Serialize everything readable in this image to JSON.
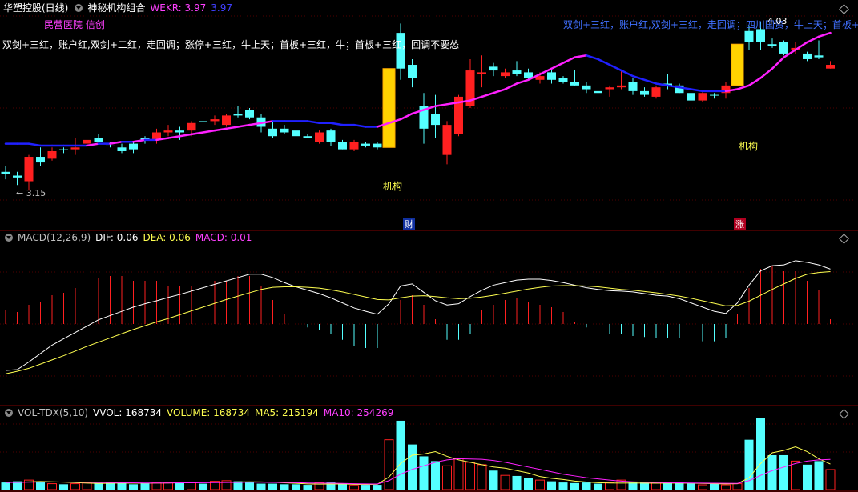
{
  "header": {
    "stock": "华塑控股(日线)",
    "indicator": "神秘机构组合",
    "wekr_label": "WEKR: 3.97",
    "wekr_value2": "3.97"
  },
  "main": {
    "tag_hospital": "民营医院 信创",
    "strategy_left": "双剑+三红，账户红,双剑+二红，走回调；涨停+三红，牛上天；首板+三红，牛；首板+三红，回调不要怂",
    "strategy_right": "双剑+三红，账户红,双剑+三红，走回调；四川国资，牛上天；首板+",
    "label_jigou": "机构",
    "low_marker": "← 3.15",
    "peak_marker": "4.03",
    "marker_cai": "财",
    "marker_zhang": "涨"
  },
  "macd_header": {
    "title": "MACD(12,26,9)",
    "dif": "DIF: 0.06",
    "dea": "DEA: 0.06",
    "macd": "MACD: 0.01"
  },
  "vol_header": {
    "title": "VOL-TDX(5,10)",
    "vvol": "VVOL: 168734",
    "volume": "VOLUME: 168734",
    "ma5": "MA5: 215194",
    "ma10": "MA10: 254269"
  },
  "colors": {
    "up": "#ff2020",
    "down": "#54ffff",
    "ma_blue": "#2020ff",
    "ma_magenta": "#ff20ff",
    "yellow": "#ffff50",
    "white": "#ffffff",
    "grid_red": "#800000"
  },
  "chart_data": {
    "type": "candlestick",
    "price_range": [
      3.1,
      4.08
    ],
    "candles": [
      {
        "o": 3.25,
        "h": 3.28,
        "l": 3.21,
        "c": 3.24,
        "up": false
      },
      {
        "o": 3.23,
        "h": 3.25,
        "l": 3.18,
        "c": 3.22,
        "up": false
      },
      {
        "o": 3.2,
        "h": 3.34,
        "l": 3.15,
        "c": 3.33,
        "up": true
      },
      {
        "o": 3.33,
        "h": 3.38,
        "l": 3.28,
        "c": 3.3,
        "up": false
      },
      {
        "o": 3.32,
        "h": 3.38,
        "l": 3.31,
        "c": 3.36,
        "up": true
      },
      {
        "o": 3.37,
        "h": 3.38,
        "l": 3.35,
        "c": 3.37,
        "up": false
      },
      {
        "o": 3.37,
        "h": 3.43,
        "l": 3.34,
        "c": 3.38,
        "up": true
      },
      {
        "o": 3.4,
        "h": 3.44,
        "l": 3.38,
        "c": 3.42,
        "up": true
      },
      {
        "o": 3.43,
        "h": 3.45,
        "l": 3.41,
        "c": 3.41,
        "up": false
      },
      {
        "o": 3.39,
        "h": 3.41,
        "l": 3.38,
        "c": 3.39,
        "up": false
      },
      {
        "o": 3.38,
        "h": 3.4,
        "l": 3.35,
        "c": 3.36,
        "up": false
      },
      {
        "o": 3.37,
        "h": 3.41,
        "l": 3.35,
        "c": 3.4,
        "up": false
      },
      {
        "o": 3.42,
        "h": 3.44,
        "l": 3.4,
        "c": 3.43,
        "up": false
      },
      {
        "o": 3.42,
        "h": 3.48,
        "l": 3.4,
        "c": 3.46,
        "up": true
      },
      {
        "o": 3.46,
        "h": 3.5,
        "l": 3.44,
        "c": 3.47,
        "up": true
      },
      {
        "o": 3.47,
        "h": 3.49,
        "l": 3.42,
        "c": 3.46,
        "up": false
      },
      {
        "o": 3.47,
        "h": 3.52,
        "l": 3.44,
        "c": 3.51,
        "up": true
      },
      {
        "o": 3.52,
        "h": 3.54,
        "l": 3.51,
        "c": 3.52,
        "up": false
      },
      {
        "o": 3.52,
        "h": 3.55,
        "l": 3.5,
        "c": 3.53,
        "up": true
      },
      {
        "o": 3.5,
        "h": 3.56,
        "l": 3.49,
        "c": 3.55,
        "up": true
      },
      {
        "o": 3.56,
        "h": 3.6,
        "l": 3.54,
        "c": 3.55,
        "up": false
      },
      {
        "o": 3.58,
        "h": 3.59,
        "l": 3.53,
        "c": 3.54,
        "up": false
      },
      {
        "o": 3.54,
        "h": 3.56,
        "l": 3.46,
        "c": 3.49,
        "up": false
      },
      {
        "o": 3.48,
        "h": 3.52,
        "l": 3.43,
        "c": 3.44,
        "up": false
      },
      {
        "o": 3.46,
        "h": 3.5,
        "l": 3.45,
        "c": 3.48,
        "up": false
      },
      {
        "o": 3.47,
        "h": 3.48,
        "l": 3.43,
        "c": 3.44,
        "up": false
      },
      {
        "o": 3.44,
        "h": 3.45,
        "l": 3.43,
        "c": 3.43,
        "up": false
      },
      {
        "o": 3.41,
        "h": 3.47,
        "l": 3.4,
        "c": 3.46,
        "up": true
      },
      {
        "o": 3.47,
        "h": 3.48,
        "l": 3.39,
        "c": 3.41,
        "up": false
      },
      {
        "o": 3.41,
        "h": 3.42,
        "l": 3.37,
        "c": 3.37,
        "up": false
      },
      {
        "o": 3.37,
        "h": 3.42,
        "l": 3.36,
        "c": 3.41,
        "up": true
      },
      {
        "o": 3.4,
        "h": 3.41,
        "l": 3.38,
        "c": 3.39,
        "up": false
      },
      {
        "o": 3.4,
        "h": 3.41,
        "l": 3.37,
        "c": 3.38,
        "up": false
      },
      {
        "o": 3.38,
        "h": 3.81,
        "l": 3.38,
        "c": 3.8,
        "up": true,
        "special": true
      },
      {
        "o": 3.8,
        "h": 4.04,
        "l": 3.74,
        "c": 3.99,
        "up": false
      },
      {
        "o": 3.82,
        "h": 3.85,
        "l": 3.7,
        "c": 3.75,
        "up": false
      },
      {
        "o": 3.6,
        "h": 3.67,
        "l": 3.4,
        "c": 3.48,
        "up": false
      },
      {
        "o": 3.56,
        "h": 3.66,
        "l": 3.43,
        "c": 3.5,
        "up": false
      },
      {
        "o": 3.34,
        "h": 3.52,
        "l": 3.29,
        "c": 3.5,
        "up": true
      },
      {
        "o": 3.45,
        "h": 3.66,
        "l": 3.44,
        "c": 3.65,
        "up": true
      },
      {
        "o": 3.6,
        "h": 3.85,
        "l": 3.59,
        "c": 3.79,
        "up": true
      },
      {
        "o": 3.77,
        "h": 3.87,
        "l": 3.7,
        "c": 3.78,
        "up": true
      },
      {
        "o": 3.81,
        "h": 3.83,
        "l": 3.76,
        "c": 3.79,
        "up": false
      },
      {
        "o": 3.78,
        "h": 3.8,
        "l": 3.75,
        "c": 3.76,
        "up": true
      },
      {
        "o": 3.79,
        "h": 3.84,
        "l": 3.76,
        "c": 3.77,
        "up": false
      },
      {
        "o": 3.78,
        "h": 3.8,
        "l": 3.74,
        "c": 3.75,
        "up": false
      },
      {
        "o": 3.74,
        "h": 3.78,
        "l": 3.72,
        "c": 3.76,
        "up": true
      },
      {
        "o": 3.78,
        "h": 3.8,
        "l": 3.72,
        "c": 3.74,
        "up": false
      },
      {
        "o": 3.75,
        "h": 3.76,
        "l": 3.72,
        "c": 3.73,
        "up": false
      },
      {
        "o": 3.73,
        "h": 3.79,
        "l": 3.71,
        "c": 3.71,
        "up": false
      },
      {
        "o": 3.71,
        "h": 3.73,
        "l": 3.67,
        "c": 3.69,
        "up": false
      },
      {
        "o": 3.68,
        "h": 3.7,
        "l": 3.66,
        "c": 3.67,
        "up": false
      },
      {
        "o": 3.7,
        "h": 3.71,
        "l": 3.65,
        "c": 3.69,
        "up": true
      },
      {
        "o": 3.7,
        "h": 3.79,
        "l": 3.69,
        "c": 3.71,
        "up": true
      },
      {
        "o": 3.73,
        "h": 3.75,
        "l": 3.66,
        "c": 3.68,
        "up": false
      },
      {
        "o": 3.68,
        "h": 3.7,
        "l": 3.65,
        "c": 3.66,
        "up": false
      },
      {
        "o": 3.65,
        "h": 3.71,
        "l": 3.64,
        "c": 3.7,
        "up": true
      },
      {
        "o": 3.71,
        "h": 3.77,
        "l": 3.69,
        "c": 3.72,
        "up": false
      },
      {
        "o": 3.71,
        "h": 3.72,
        "l": 3.67,
        "c": 3.67,
        "up": false
      },
      {
        "o": 3.67,
        "h": 3.69,
        "l": 3.62,
        "c": 3.63,
        "up": false
      },
      {
        "o": 3.63,
        "h": 3.68,
        "l": 3.62,
        "c": 3.67,
        "up": true
      },
      {
        "o": 3.66,
        "h": 3.67,
        "l": 3.64,
        "c": 3.66,
        "up": false
      },
      {
        "o": 3.67,
        "h": 3.73,
        "l": 3.64,
        "c": 3.71,
        "up": true
      },
      {
        "o": 3.71,
        "h": 3.93,
        "l": 3.71,
        "c": 3.93,
        "up": true,
        "special": true
      },
      {
        "o": 3.94,
        "h": 4.03,
        "l": 3.9,
        "c": 4.0,
        "up": false
      },
      {
        "o": 4.01,
        "h": 4.05,
        "l": 3.9,
        "c": 3.94,
        "up": false
      },
      {
        "o": 3.93,
        "h": 3.96,
        "l": 3.91,
        "c": 3.92,
        "up": false
      },
      {
        "o": 3.94,
        "h": 3.95,
        "l": 3.87,
        "c": 3.88,
        "up": false
      },
      {
        "o": 3.91,
        "h": 3.94,
        "l": 3.88,
        "c": 3.9,
        "up": true
      },
      {
        "o": 3.88,
        "h": 3.89,
        "l": 3.84,
        "c": 3.85,
        "up": false
      },
      {
        "o": 3.87,
        "h": 3.95,
        "l": 3.85,
        "c": 3.86,
        "up": false
      },
      {
        "o": 3.82,
        "h": 3.84,
        "l": 3.8,
        "c": 3.8,
        "up": true
      }
    ],
    "ma_line": [
      3.4,
      3.4,
      3.4,
      3.39,
      3.39,
      3.39,
      3.39,
      3.39,
      3.4,
      3.4,
      3.41,
      3.41,
      3.42,
      3.42,
      3.43,
      3.44,
      3.45,
      3.46,
      3.47,
      3.48,
      3.49,
      3.5,
      3.51,
      3.52,
      3.52,
      3.52,
      3.52,
      3.51,
      3.51,
      3.5,
      3.5,
      3.49,
      3.49,
      3.51,
      3.53,
      3.56,
      3.58,
      3.6,
      3.61,
      3.62,
      3.63,
      3.65,
      3.67,
      3.69,
      3.72,
      3.74,
      3.77,
      3.8,
      3.83,
      3.86,
      3.87,
      3.85,
      3.82,
      3.79,
      3.76,
      3.74,
      3.72,
      3.71,
      3.7,
      3.69,
      3.68,
      3.68,
      3.68,
      3.69,
      3.71,
      3.75,
      3.8,
      3.86,
      3.9,
      3.94,
      3.97,
      3.99
    ],
    "macd": {
      "range": [
        -0.12,
        0.18
      ],
      "dif": [
        -0.11,
        -0.108,
        -0.09,
        -0.07,
        -0.05,
        -0.035,
        -0.02,
        -0.005,
        0.01,
        0.02,
        0.03,
        0.04,
        0.048,
        0.055,
        0.063,
        0.07,
        0.078,
        0.086,
        0.094,
        0.102,
        0.11,
        0.118,
        0.118,
        0.11,
        0.098,
        0.088,
        0.08,
        0.072,
        0.062,
        0.05,
        0.038,
        0.03,
        0.023,
        0.048,
        0.09,
        0.095,
        0.075,
        0.055,
        0.045,
        0.048,
        0.065,
        0.08,
        0.092,
        0.098,
        0.104,
        0.106,
        0.106,
        0.103,
        0.098,
        0.092,
        0.086,
        0.082,
        0.079,
        0.078,
        0.076,
        0.072,
        0.068,
        0.066,
        0.06,
        0.05,
        0.04,
        0.03,
        0.025,
        0.05,
        0.092,
        0.126,
        0.138,
        0.14,
        0.15,
        0.146,
        0.14,
        0.13
      ],
      "dea": [
        -0.118,
        -0.112,
        -0.105,
        -0.095,
        -0.085,
        -0.075,
        -0.064,
        -0.053,
        -0.043,
        -0.033,
        -0.023,
        -0.013,
        -0.004,
        0.005,
        0.013,
        0.022,
        0.031,
        0.04,
        0.049,
        0.058,
        0.066,
        0.074,
        0.082,
        0.087,
        0.088,
        0.088,
        0.087,
        0.085,
        0.081,
        0.076,
        0.07,
        0.064,
        0.058,
        0.057,
        0.062,
        0.066,
        0.067,
        0.065,
        0.062,
        0.06,
        0.061,
        0.064,
        0.068,
        0.073,
        0.078,
        0.083,
        0.087,
        0.09,
        0.091,
        0.091,
        0.09,
        0.088,
        0.085,
        0.082,
        0.08,
        0.077,
        0.074,
        0.07,
        0.066,
        0.061,
        0.055,
        0.049,
        0.043,
        0.044,
        0.054,
        0.068,
        0.082,
        0.095,
        0.108,
        0.118,
        0.122,
        0.124
      ],
      "hist": [
        0.03,
        0.025,
        0.04,
        0.045,
        0.06,
        0.065,
        0.075,
        0.09,
        0.095,
        0.1,
        0.1,
        0.09,
        0.09,
        0.09,
        0.08,
        0.08,
        0.08,
        0.09,
        0.09,
        0.09,
        0.1,
        0.1,
        0.08,
        0.05,
        0.02,
        0.0,
        -0.007,
        -0.013,
        -0.02,
        -0.033,
        -0.045,
        -0.05,
        -0.05,
        -0.035,
        0.05,
        0.06,
        0.04,
        0.01,
        -0.033,
        -0.033,
        -0.02,
        0.03,
        0.04,
        0.05,
        0.055,
        0.045,
        0.04,
        0.035,
        0.025,
        0.005,
        -0.007,
        -0.013,
        -0.02,
        -0.02,
        -0.025,
        -0.027,
        -0.03,
        -0.03,
        -0.03,
        -0.033,
        -0.036,
        -0.036,
        -0.03,
        0.02,
        0.075,
        0.115,
        0.12,
        0.11,
        0.11,
        0.09,
        0.07,
        0.01
      ]
    },
    "volume": {
      "range": [
        0,
        620000
      ],
      "vol": [
        60000,
        70000,
        80000,
        70000,
        50000,
        45000,
        50000,
        60000,
        55000,
        60000,
        55000,
        45000,
        55000,
        60000,
        60000,
        65000,
        60000,
        50000,
        70000,
        75000,
        70000,
        65000,
        50000,
        50000,
        45000,
        45000,
        40000,
        60000,
        60000,
        45000,
        35000,
        40000,
        40000,
        420000,
        580000,
        380000,
        280000,
        240000,
        200000,
        260000,
        230000,
        210000,
        160000,
        120000,
        115000,
        100000,
        80000,
        70000,
        60000,
        55000,
        60000,
        50000,
        60000,
        80000,
        60000,
        60000,
        55000,
        60000,
        60000,
        55000,
        40000,
        50000,
        40000,
        50000,
        420000,
        600000,
        290000,
        290000,
        240000,
        210000,
        240000,
        168734
      ],
      "ma5": [
        60000,
        62000,
        65000,
        68000,
        66000,
        63000,
        59000,
        55000,
        52000,
        54000,
        56000,
        55000,
        54000,
        55000,
        56000,
        58000,
        60000,
        61000,
        62000,
        63000,
        65000,
        66000,
        65000,
        62000,
        57000,
        53000,
        48000,
        46000,
        47000,
        48000,
        45000,
        44000,
        45000,
        106000,
        220000,
        290000,
        300000,
        320000,
        280000,
        250000,
        230000,
        210000,
        190000,
        180000,
        160000,
        140000,
        110000,
        95000,
        85000,
        72000,
        64000,
        58000,
        56000,
        55000,
        56000,
        55000,
        54000,
        55000,
        55000,
        54000,
        52000,
        50000,
        48000,
        50000,
        100000,
        220000,
        310000,
        330000,
        360000,
        320000,
        260000,
        215194
      ],
      "ma10": [
        60000,
        61000,
        62000,
        63000,
        64000,
        64000,
        63000,
        62000,
        60000,
        59000,
        58000,
        57000,
        56000,
        56000,
        56000,
        57000,
        57000,
        58000,
        59000,
        60000,
        61000,
        62000,
        62000,
        61000,
        60000,
        58000,
        56000,
        55000,
        54000,
        52000,
        50000,
        48000,
        47000,
        75000,
        130000,
        170000,
        200000,
        230000,
        250000,
        260000,
        258000,
        255000,
        245000,
        230000,
        210000,
        190000,
        170000,
        150000,
        130000,
        115000,
        100000,
        90000,
        80000,
        72000,
        66000,
        62000,
        60000,
        58000,
        57000,
        56000,
        55000,
        54000,
        53000,
        52000,
        75000,
        120000,
        160000,
        190000,
        220000,
        240000,
        250000,
        254269
      ]
    }
  }
}
